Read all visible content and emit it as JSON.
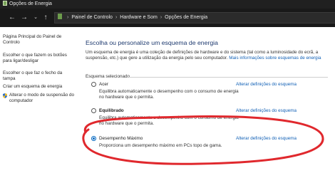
{
  "window": {
    "title": "Opções de Energia"
  },
  "nav": {
    "back_icon": "back-arrow-icon",
    "forward_icon": "forward-arrow-icon",
    "dropdown_icon": "chevron-down-icon",
    "up_icon": "up-arrow-icon",
    "breadcrumb": [
      "Painel de Controlo",
      "Hardware e Som",
      "Opções de Energia"
    ]
  },
  "sidebar": {
    "items": [
      "Página Principal do Painel de Controlo",
      "Escolher o que fazem os botões para ligar/desligar",
      "Escolher o que faz o fecho da tampa",
      "Criar um esquema de energia",
      "Alterar o modo de suspensão do computador"
    ]
  },
  "main": {
    "title": "Escolha ou personalize um esquema de energia",
    "description": "Um esquema de energia é uma coleção de definições de hardware e do sistema (tal como a luminosidade do ecrã, a suspensão, etc.) que gere a utilização da energia pelo seu computador. ",
    "more_info_link": "Mais informações sobre esquemas de energia",
    "section_label": "Esquema selecionado",
    "plans": [
      {
        "name": "Acer",
        "description": "Equilibra automaticamente o desempenho com o consumo de energia no hardware que o permita.",
        "link": "Alterar definições do esquema",
        "selected": false
      },
      {
        "name": "Equilibrado",
        "description": "Equilibra automaticamente o desempenho com o consumo de energia no hardware que o permita.",
        "link": "Alterar definições do esquema",
        "selected": false
      },
      {
        "name": "Desempenho Máximo",
        "description": "Proporciona um desempenho máximo em PCs topo de gama.",
        "link": "Alterar definições do esquema",
        "selected": true
      }
    ]
  },
  "colors": {
    "title_text": "#1e3a6f",
    "link": "#0f5fb5",
    "radio_selected": "#0067c0",
    "annotation": "#e0282d",
    "titlebar_bg": "#202020"
  }
}
